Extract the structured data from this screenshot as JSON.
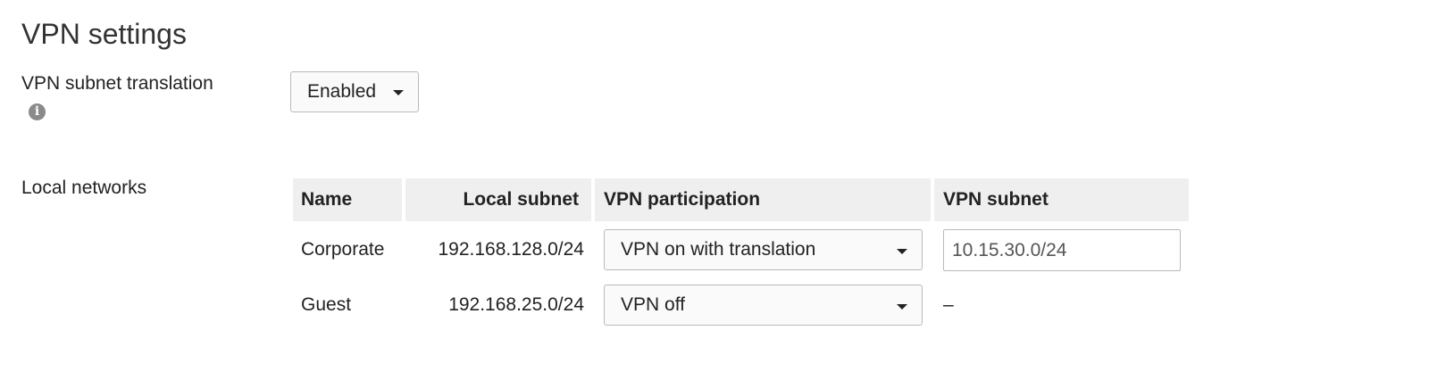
{
  "page": {
    "title": "VPN settings"
  },
  "translation": {
    "label": "VPN subnet translation",
    "info_icon": "info-icon",
    "value": "Enabled"
  },
  "local_networks": {
    "label": "Local networks",
    "headers": [
      "Name",
      "Local subnet",
      "VPN participation",
      "VPN subnet"
    ],
    "rows": [
      {
        "name": "Corporate",
        "local_subnet": "192.168.128.0/24",
        "participation": "VPN on with translation",
        "vpn_subnet": "10.15.30.0/24"
      },
      {
        "name": "Guest",
        "local_subnet": "192.168.25.0/24",
        "participation": "VPN off",
        "vpn_subnet": "–"
      }
    ]
  }
}
